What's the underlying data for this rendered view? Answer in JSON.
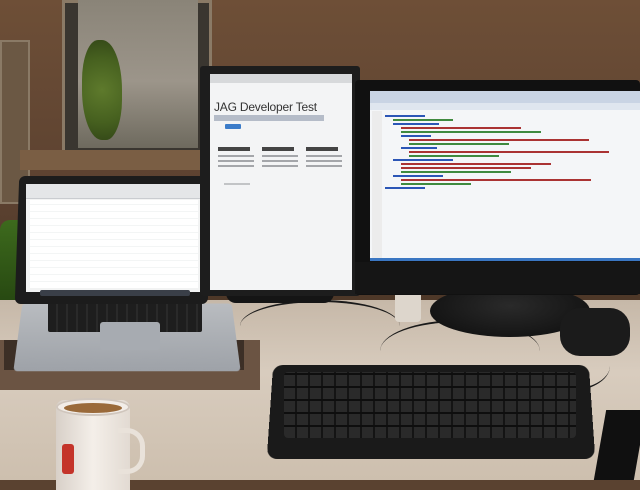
{
  "scene": {
    "description_hidden": false,
    "portrait_monitor": {
      "page_title": "JAG Developer Test",
      "columns": [
        {
          "heading": "Getting started"
        },
        {
          "heading": "Connect to the Tins World"
        },
        {
          "heading": "Web Hosting"
        }
      ]
    }
  },
  "colors": {
    "wall": "#5b4130",
    "desk": "#d8ccbe",
    "screen_bg": "#f3f4f5",
    "link_blue": "#3c7cc9"
  }
}
